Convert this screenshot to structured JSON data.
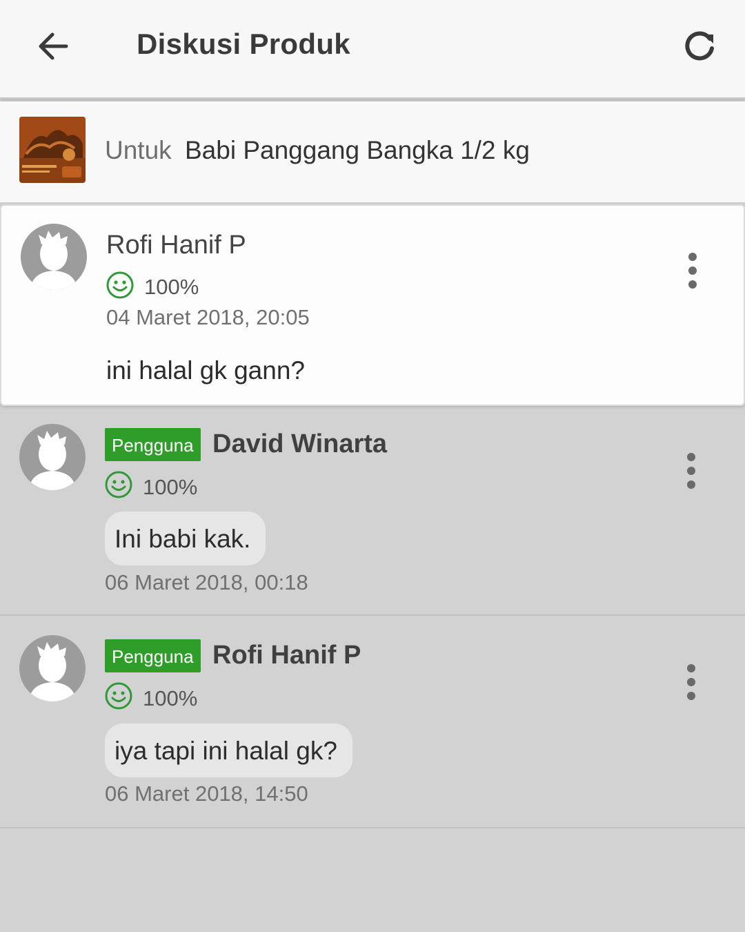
{
  "appbar": {
    "title": "Diskusi Produk",
    "back_icon": "arrow-left-icon",
    "refresh_icon": "refresh-icon"
  },
  "product": {
    "label": "Untuk",
    "name": "Babi Panggang Bangka 1/2 kg"
  },
  "question": {
    "user": "Rofi Hanif P",
    "rating": "100%",
    "time": "04 Maret 2018, 20:05",
    "text": "ini halal gk gann?"
  },
  "replies": [
    {
      "badge": "Pengguna",
      "user": "David Winarta",
      "rating": "100%",
      "text": "Ini babi kak.",
      "time": "06 Maret 2018, 00:18"
    },
    {
      "badge": "Pengguna",
      "user": "Rofi Hanif P",
      "rating": "100%",
      "text": "iya tapi ini halal gk?",
      "time": "06 Maret 2018, 14:50"
    }
  ],
  "colors": {
    "badge_green": "#2e9d2a",
    "rating_green": "#2f9a35",
    "background_gray": "#d2d2d2"
  }
}
